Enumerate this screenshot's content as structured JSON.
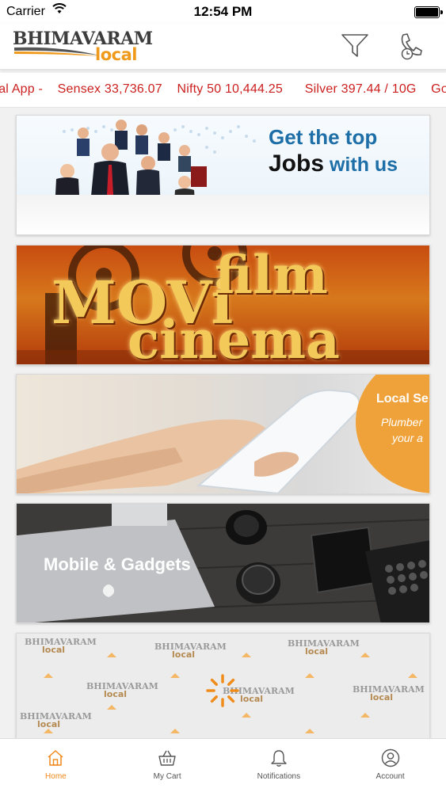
{
  "status_bar": {
    "carrier": "Carrier",
    "time": "12:54 PM"
  },
  "header": {
    "logo_top": "BHIMAVARAM",
    "logo_bottom": "local",
    "filter_icon": "filter-funnel-icon",
    "phone_icon": "phone-clock-icon"
  },
  "ticker": {
    "items": [
      "cal App -",
      "Sensex 33,736.07",
      "Nifty 50 10,444.25",
      "Silver 397.44 / 10G",
      "Go"
    ]
  },
  "banners": {
    "jobs": {
      "line1": "Get the top",
      "line2_bold": "Jobs",
      "line2_rest": " with us"
    },
    "movie": {
      "word1": "MOVi",
      "word2": "film",
      "word3": "cinema"
    },
    "services": {
      "title": "Local Se",
      "sub1": "Plumber",
      "sub2": "your a"
    },
    "mobile": {
      "title": "Mobile & Gadgets"
    },
    "brand": {
      "mark_top": "BHIMAVARAM",
      "mark_bottom": "local"
    }
  },
  "tabbar": {
    "tabs": [
      {
        "label": "Home",
        "icon": "home-icon",
        "active": true
      },
      {
        "label": "My Cart",
        "icon": "cart-basket-icon",
        "active": false
      },
      {
        "label": "Notifications",
        "icon": "bell-icon",
        "active": false
      },
      {
        "label": "Account",
        "icon": "user-circle-icon",
        "active": false
      }
    ]
  },
  "colors": {
    "accent": "#f0881c",
    "ticker_text": "#cc1f1f",
    "jobs_blue": "#1e6fa8"
  }
}
